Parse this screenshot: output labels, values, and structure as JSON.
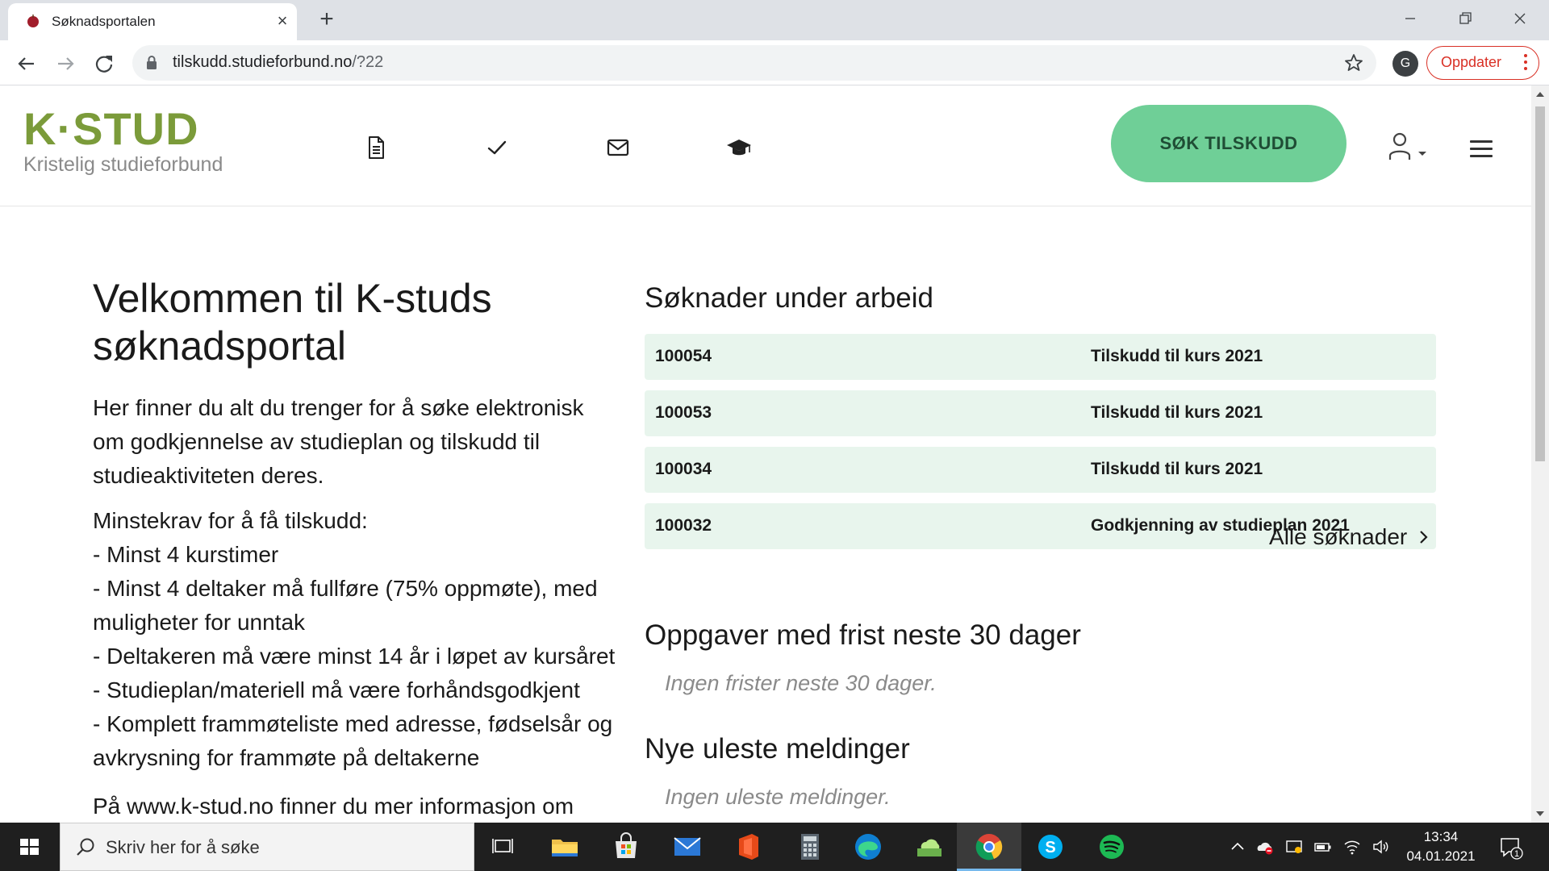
{
  "browser": {
    "tab_title": "Søknadsportalen",
    "url_host": "tilskudd.studieforbund.no",
    "url_path": "/?22",
    "profile_initial": "G",
    "update_label": "Oppdater"
  },
  "site": {
    "logo_mark": "K·STUD",
    "logo_sub": "Kristelig studieforbund",
    "apply_button": "SØK TILSKUDD"
  },
  "intro": {
    "title": "Velkommen til K-studs søknadsportal",
    "paragraph": "Her finner du alt du trenger for å søke elektronisk om godkjennelse av studieplan og tilskudd til studieaktiviteten deres.",
    "requirements_title": "Minstekrav for å få tilskudd:",
    "requirements": [
      "- Minst 4 kurstimer",
      "- Minst 4 deltaker må fullføre (75% oppmøte), med muligheter for unntak",
      "- Deltakeren må være minst 14 år i løpet av kursåret",
      "- Studieplan/materiell må være forhåndsgodkjent",
      "- Komplett frammøteliste med adresse, fødselsår og avkrysning for frammøte på deltakerne"
    ],
    "more_info": "På www.k-stud.no finner du mer informasjon om"
  },
  "applications": {
    "title": "Søknader under arbeid",
    "rows": [
      {
        "id": "100054",
        "name": "Tilskudd til kurs 2021"
      },
      {
        "id": "100053",
        "name": "Tilskudd til kurs 2021"
      },
      {
        "id": "100034",
        "name": "Tilskudd til kurs 2021"
      },
      {
        "id": "100032",
        "name": "Godkjenning av studieplan 2021"
      }
    ],
    "all_link": "Alle søknader"
  },
  "tasks": {
    "title": "Oppgaver med frist neste 30 dager",
    "empty": "Ingen frister neste 30 dager."
  },
  "messages": {
    "title": "Nye uleste meldinger",
    "empty": "Ingen uleste meldinger."
  },
  "taskbar": {
    "search_placeholder": "Skriv her for å søke",
    "time": "13:34",
    "date": "04.01.2021",
    "notification_count": "1"
  },
  "colors": {
    "brand_green": "#7b9b3a",
    "accent_button": "#6fcf97",
    "row_bg": "#e8f5ed",
    "update_red": "#d93025"
  }
}
